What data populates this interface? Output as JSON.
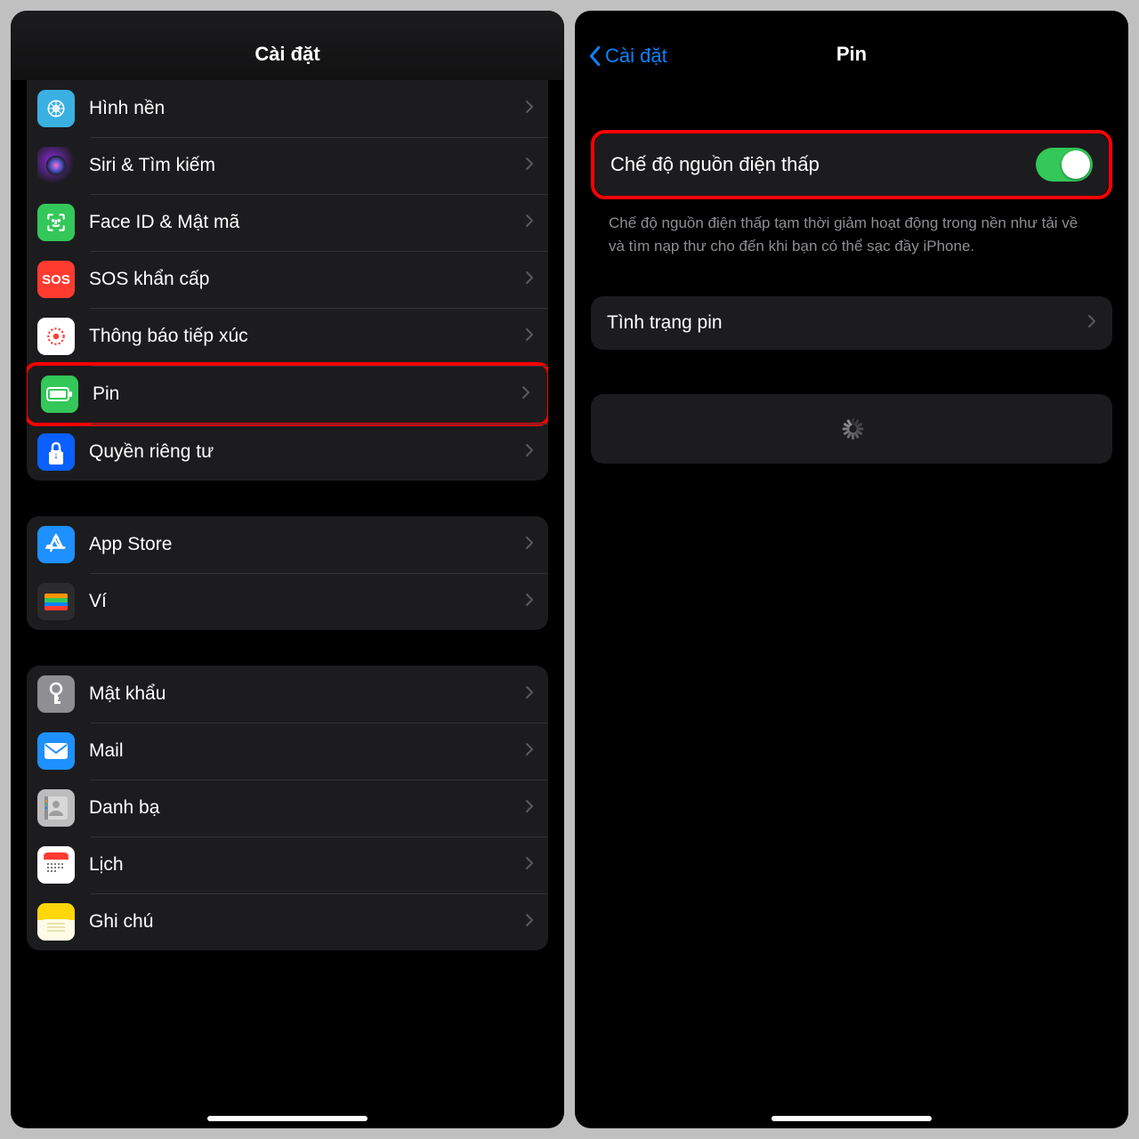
{
  "left": {
    "title": "Cài đặt",
    "groups": [
      {
        "rows": [
          {
            "label": "Hình nền",
            "icon": "wallpaper"
          },
          {
            "label": "Siri & Tìm kiếm",
            "icon": "siri"
          },
          {
            "label": "Face ID & Mật mã",
            "icon": "faceid"
          },
          {
            "label": "SOS khẩn cấp",
            "icon": "sos"
          },
          {
            "label": "Thông báo tiếp xúc",
            "icon": "exposure"
          },
          {
            "label": "Pin",
            "icon": "battery",
            "highlight": true
          },
          {
            "label": "Quyền riêng tư",
            "icon": "privacy"
          }
        ]
      },
      {
        "rows": [
          {
            "label": "App Store",
            "icon": "appstore"
          },
          {
            "label": "Ví",
            "icon": "wallet"
          }
        ]
      },
      {
        "rows": [
          {
            "label": "Mật khẩu",
            "icon": "password"
          },
          {
            "label": "Mail",
            "icon": "mail"
          },
          {
            "label": "Danh bạ",
            "icon": "contacts"
          },
          {
            "label": "Lịch",
            "icon": "calendar"
          },
          {
            "label": "Ghi chú",
            "icon": "notes"
          }
        ]
      }
    ]
  },
  "right": {
    "back": "Cài đặt",
    "title": "Pin",
    "lowpower_label": "Chế độ nguồn điện thấp",
    "lowpower_on": true,
    "lowpower_desc": "Chế độ nguồn điện thấp tạm thời giảm hoạt động trong nền như tải về và tìm nạp thư cho đến khi bạn có thể sạc đầy iPhone.",
    "health_label": "Tình trạng pin"
  }
}
